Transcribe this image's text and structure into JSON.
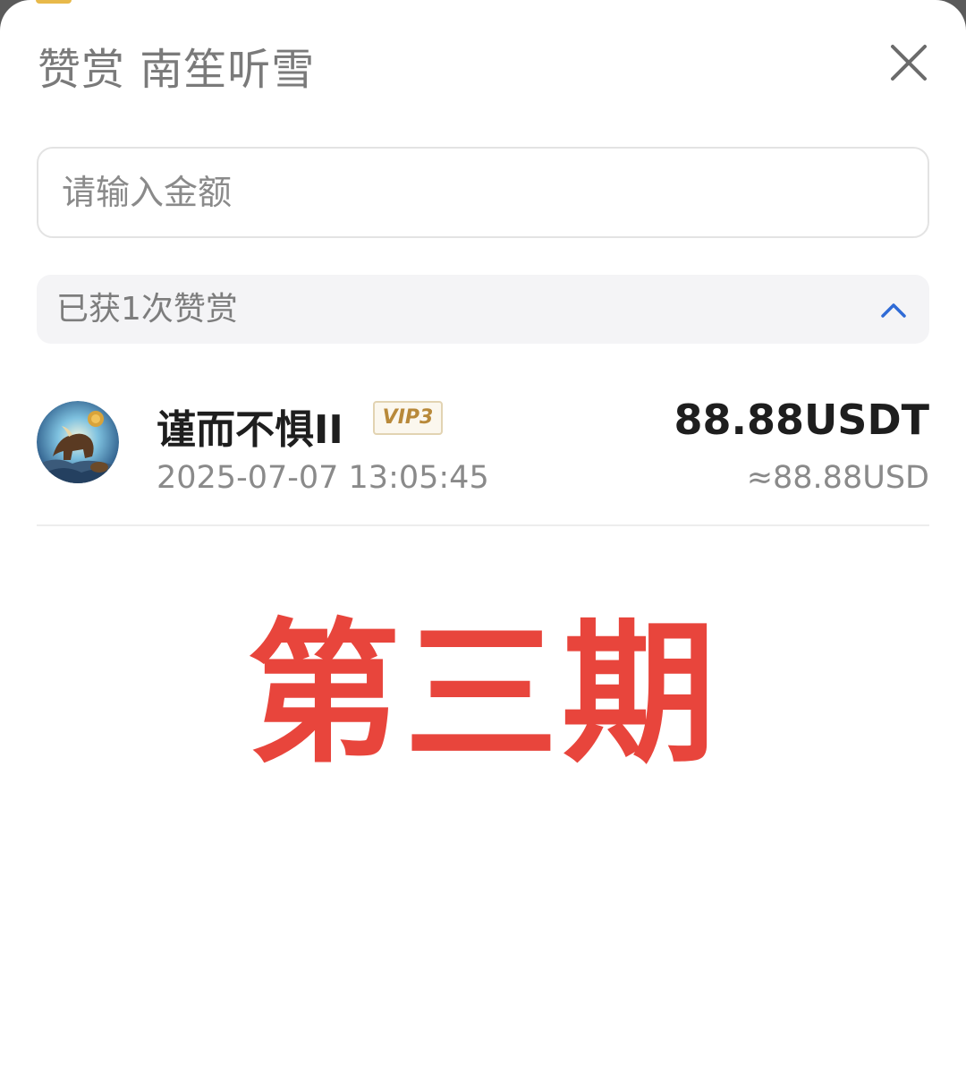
{
  "dialog": {
    "title": "赞赏 南笙听雪"
  },
  "amount_input": {
    "placeholder": "请输入金额"
  },
  "summary": {
    "text": "已获1次赞赏",
    "chevron_icon": "chevron-up-icon"
  },
  "records": [
    {
      "name": "谨而不惧II",
      "vip": "VIP3",
      "time": "2025-07-07 13:05:45",
      "amount": "88.88USDT",
      "approx": "≈88.88USD"
    }
  ],
  "overlay": {
    "text": "第三期"
  },
  "colors": {
    "accent": "#2f6bd6",
    "overlay_red": "#e8453c",
    "vip_gold": "#b8893a"
  }
}
